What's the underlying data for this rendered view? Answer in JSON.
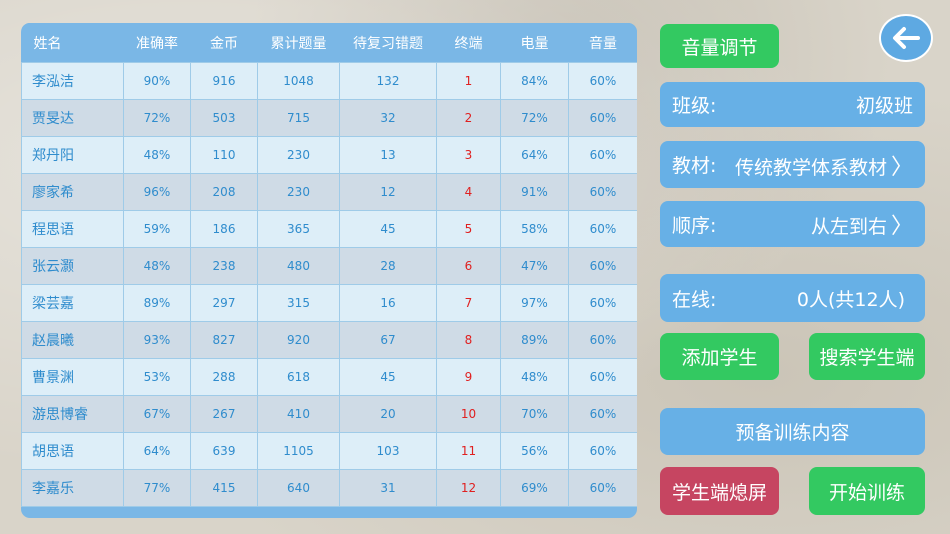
{
  "table": {
    "headers": [
      "姓名",
      "准确率",
      "金币",
      "累计题量",
      "待复习错题",
      "终端",
      "电量",
      "音量"
    ],
    "rows": [
      [
        "李泓洁",
        "90%",
        "916",
        "1048",
        "132",
        "1",
        "84%",
        "60%"
      ],
      [
        "贾旻达",
        "72%",
        "503",
        "715",
        "32",
        "2",
        "72%",
        "60%"
      ],
      [
        "郑丹阳",
        "48%",
        "110",
        "230",
        "13",
        "3",
        "64%",
        "60%"
      ],
      [
        "廖家希",
        "96%",
        "208",
        "230",
        "12",
        "4",
        "91%",
        "60%"
      ],
      [
        "程思语",
        "59%",
        "186",
        "365",
        "45",
        "5",
        "58%",
        "60%"
      ],
      [
        "张云灏",
        "48%",
        "238",
        "480",
        "28",
        "6",
        "47%",
        "60%"
      ],
      [
        "梁芸嘉",
        "89%",
        "297",
        "315",
        "16",
        "7",
        "97%",
        "60%"
      ],
      [
        "赵晨曦",
        "93%",
        "827",
        "920",
        "67",
        "8",
        "89%",
        "60%"
      ],
      [
        "曹景渊",
        "53%",
        "288",
        "618",
        "45",
        "9",
        "48%",
        "60%"
      ],
      [
        "游思博睿",
        "67%",
        "267",
        "410",
        "20",
        "10",
        "70%",
        "60%"
      ],
      [
        "胡思语",
        "64%",
        "639",
        "1105",
        "103",
        "11",
        "56%",
        "60%"
      ],
      [
        "李嘉乐",
        "77%",
        "415",
        "640",
        "31",
        "12",
        "69%",
        "60%"
      ]
    ]
  },
  "controls": {
    "volume_label": "音量调节",
    "class_label": "班级:",
    "class_value": "初级班",
    "material_label": "教材:",
    "material_value": "传统教学体系教材",
    "order_label": "顺序:",
    "order_value": "从左到右",
    "online_label": "在线:",
    "online_value": "0人(共12人)",
    "add_student": "添加学生",
    "search_student": "搜索学生端",
    "prepare_content": "预备训练内容",
    "screen_off": "学生端熄屏",
    "start_training": "开始训练"
  },
  "colors": {
    "green": "#33c961",
    "blue": "#67b0e6",
    "red": "#c64561",
    "terminal_text": "#e02020"
  },
  "icons": {
    "back": "arrow-left-icon",
    "chevron": "chevron-right-icon"
  }
}
